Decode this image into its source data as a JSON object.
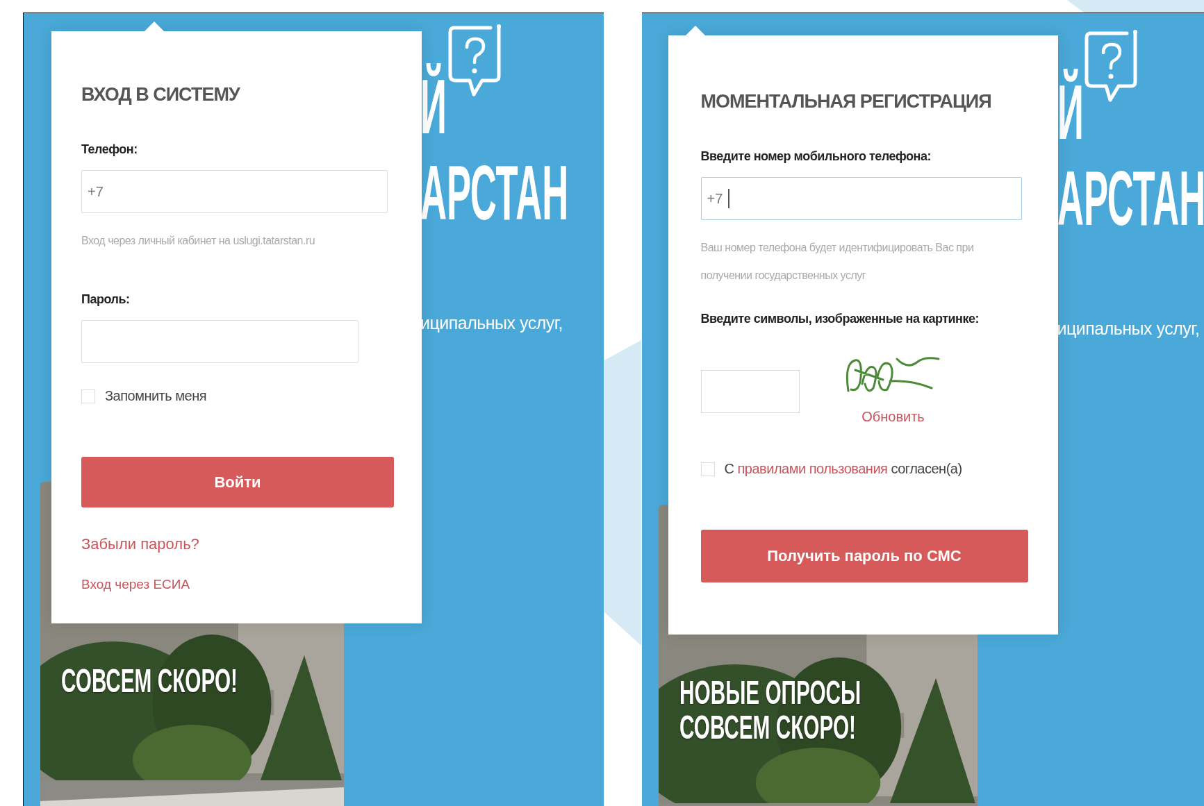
{
  "panels": [
    {
      "kind": "login",
      "hero": {
        "title_fragments": [
          "Й",
          "АРСТАН"
        ],
        "text_fragment": "иципальных услуг,",
        "card_title_lines": [
          "СОВСЕМ СКОРО!"
        ]
      },
      "popup": {
        "items": [
          {
            "kind": "title",
            "text": "ВХОД В СИСТЕМУ"
          },
          {
            "kind": "label",
            "text": "Телефон:"
          },
          {
            "kind": "field",
            "value": "+7",
            "focused": false
          },
          {
            "kind": "hint",
            "text": "Вход через личный кабинет на uslugi.tatarstan.ru"
          },
          {
            "kind": "label",
            "text": "Пароль:"
          },
          {
            "kind": "password"
          },
          {
            "kind": "checkbox",
            "text": "Запомнить меня",
            "checked": false
          },
          {
            "kind": "button",
            "text": "Войти"
          },
          {
            "kind": "link",
            "text": "Забыли пароль?"
          },
          {
            "kind": "link",
            "text": "Вход через ЕСИА"
          }
        ]
      }
    },
    {
      "kind": "register",
      "hero": {
        "title_fragments": [
          "Й",
          "АРСТАН"
        ],
        "text_fragment": "иципальных услуг,",
        "card_title_lines": [
          "НОВЫЕ ОПРОСЫ",
          "СОВСЕМ СКОРО!"
        ]
      },
      "popup": {
        "items": [
          {
            "kind": "title",
            "text": "МОМЕНТАЛЬНАЯ РЕГИСТРАЦИЯ"
          },
          {
            "kind": "label",
            "text": "Введите номер мобильного телефона:"
          },
          {
            "kind": "field",
            "value": "+7",
            "focused": true
          },
          {
            "kind": "hint",
            "text": "Ваш номер телефона будет идентифицировать Вас при получении государственных услуг"
          },
          {
            "kind": "label",
            "text": "Введите символы, изображенные на картинке:"
          },
          {
            "kind": "captcha",
            "refresh": "Обновить"
          },
          {
            "kind": "checkbox",
            "text": "С",
            "link": "правилами пользования",
            "text_after": "согласен(а)",
            "checked": false
          },
          {
            "kind": "button",
            "text": "Получить пароль по СМС"
          }
        ]
      }
    }
  ]
}
